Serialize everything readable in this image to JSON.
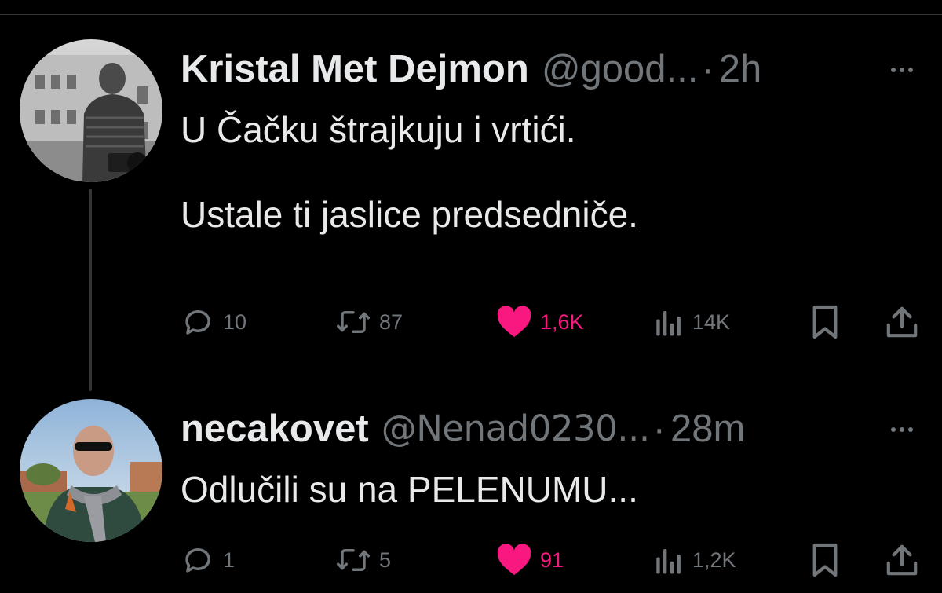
{
  "tweets": [
    {
      "author": {
        "name": "Kristal Met Dejmon",
        "handle": "@good...",
        "time": "2h"
      },
      "text": "U Čačku štrajkuju i vrtići.\n\nUstale ti jaslice predsedniče.",
      "stats": {
        "replies": "10",
        "retweets": "87",
        "likes": "1,6K",
        "views": "14K"
      }
    },
    {
      "author": {
        "name": "necakovet",
        "handle": "@Nenad0230...",
        "time": "28m"
      },
      "text": "Odlučili su na PELENUMU...",
      "stats": {
        "replies": "1",
        "retweets": "5",
        "likes": "91",
        "views": "1,2K"
      }
    }
  ],
  "ui": {
    "separator": "·",
    "icons": {
      "reply": "reply-icon",
      "retweet": "retweet-icon",
      "like": "heart-icon",
      "views": "views-icon",
      "bookmark": "bookmark-icon",
      "share": "share-icon",
      "more": "more-icon"
    },
    "colors": {
      "background": "#000000",
      "text": "#e7e9ea",
      "secondary": "#71767b",
      "like": "#f91880"
    }
  }
}
